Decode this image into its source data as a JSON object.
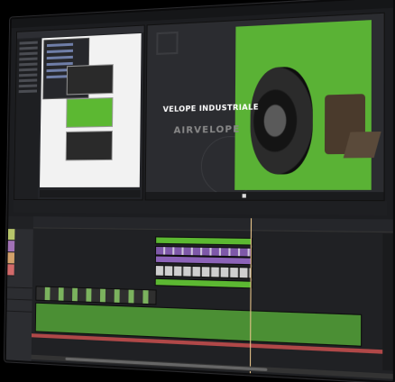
{
  "program": {
    "title_line1": "VELOPE INDUSTRIALE",
    "title_line2": "AIRVELOPE"
  },
  "colors": {
    "accent_green": "#5cb832",
    "panel_bg": "#1c1d20",
    "clip_purple": "#8c63b8",
    "audio_red": "#b04848",
    "playhead": "#e8c48a"
  },
  "icons": [
    "play-icon",
    "track-lock-icon",
    "eye-icon",
    "speaker-icon"
  ]
}
